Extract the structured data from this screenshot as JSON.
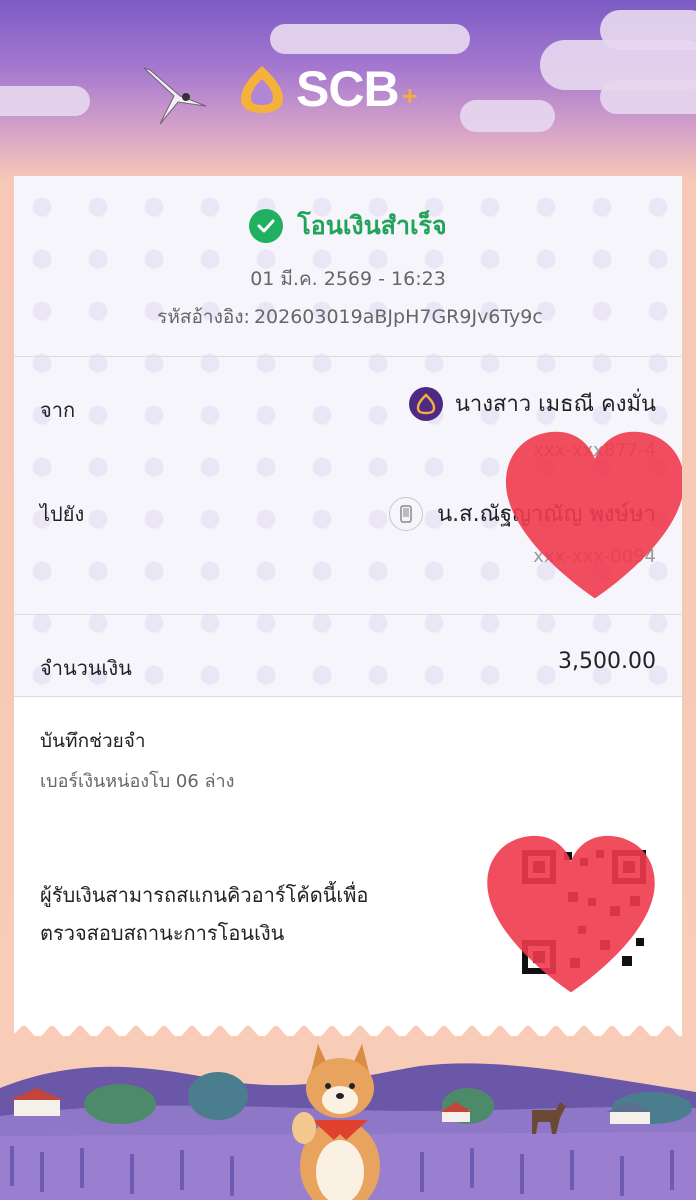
{
  "brand": {
    "logo_text": "SCB",
    "logo_plus": "+"
  },
  "transfer": {
    "status": "โอนเงินสำเร็จ",
    "datetime": "01 มี.ค. 2569 - 16:23",
    "ref_label": "รหัสอ้างอิง:",
    "ref_value": "202603019aBJpH7GR9Jv6Ty9c"
  },
  "from": {
    "label": "จาก",
    "name": "นางสาว เมธณี คงมั่น",
    "account": "xxx-xxx877-4"
  },
  "to": {
    "label": "ไปยัง",
    "name": "น.ส.ณัฐญาณัญ พงษ์ษา",
    "account": "xxx-xxx-0094"
  },
  "amount": {
    "label": "จำนวนเงิน",
    "value": "3,500.00"
  },
  "memo": {
    "label": "บันทึกช่วยจำ",
    "text": "เบอร์เงินหน่องโบ 06 ล่าง"
  },
  "qr": {
    "line1": "ผู้รับเงินสามารถสแกนคิวอาร์โค้ดนี้เพื่อ",
    "line2": "ตรวจสอบสถานะการโอนเงิน"
  },
  "colors": {
    "success": "#21a45a",
    "brand_purple": "#4e2a84",
    "brand_gold": "#f6b03a",
    "heart": "#ee3b4e"
  },
  "icons": [
    "check-icon",
    "scb-bank-icon",
    "mobile-phone-icon",
    "qr-code",
    "heart-sticker"
  ]
}
